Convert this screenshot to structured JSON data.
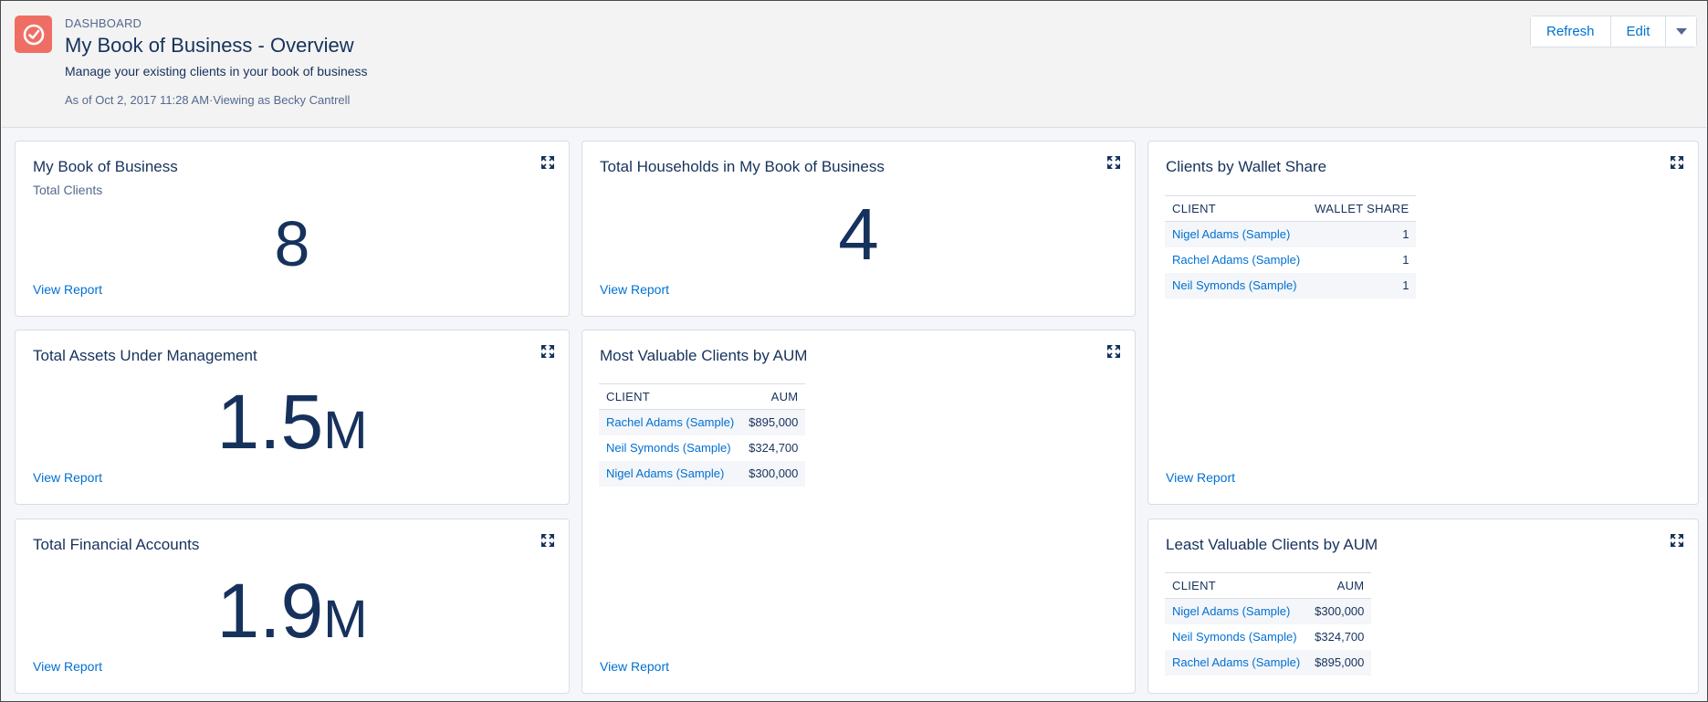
{
  "header": {
    "eyebrow": "DASHBOARD",
    "title": "My Book of Business - Overview",
    "description": "Manage your existing clients in your book of business",
    "meta": "As of Oct 2, 2017 11:28 AM·Viewing as Becky Cantrell",
    "buttons": {
      "refresh": "Refresh",
      "edit": "Edit"
    },
    "accent": "#ef6e64"
  },
  "view_report": "View Report",
  "cards": {
    "book": {
      "title": "My Book of Business",
      "subtitle": "Total Clients",
      "value": "8"
    },
    "households": {
      "title": "Total Households in My Book of Business",
      "value": "4"
    },
    "assets": {
      "title": "Total Assets Under Management",
      "value": "1.5",
      "suffix": "M"
    },
    "financial": {
      "title": "Total Financial Accounts",
      "value": "1.9",
      "suffix": "M"
    },
    "most_valuable": {
      "title": "Most Valuable Clients by AUM",
      "col_client": "CLIENT",
      "col_value": "AUM",
      "rows": [
        {
          "client": "Rachel Adams (Sample)",
          "value": "$895,000"
        },
        {
          "client": "Neil Symonds (Sample)",
          "value": "$324,700"
        },
        {
          "client": "Nigel Adams (Sample)",
          "value": "$300,000"
        }
      ]
    },
    "wallet": {
      "title": "Clients by Wallet Share",
      "col_client": "CLIENT",
      "col_value": "WALLET SHARE",
      "rows": [
        {
          "client": "Nigel Adams (Sample)",
          "value": "1"
        },
        {
          "client": "Rachel Adams (Sample)",
          "value": "1"
        },
        {
          "client": "Neil Symonds (Sample)",
          "value": "1"
        }
      ]
    },
    "least_valuable": {
      "title": "Least Valuable Clients by AUM",
      "col_client": "CLIENT",
      "col_value": "AUM",
      "rows": [
        {
          "client": "Nigel Adams (Sample)",
          "value": "$300,000"
        },
        {
          "client": "Neil Symonds (Sample)",
          "value": "$324,700"
        },
        {
          "client": "Rachel Adams (Sample)",
          "value": "$895,000"
        }
      ]
    }
  }
}
